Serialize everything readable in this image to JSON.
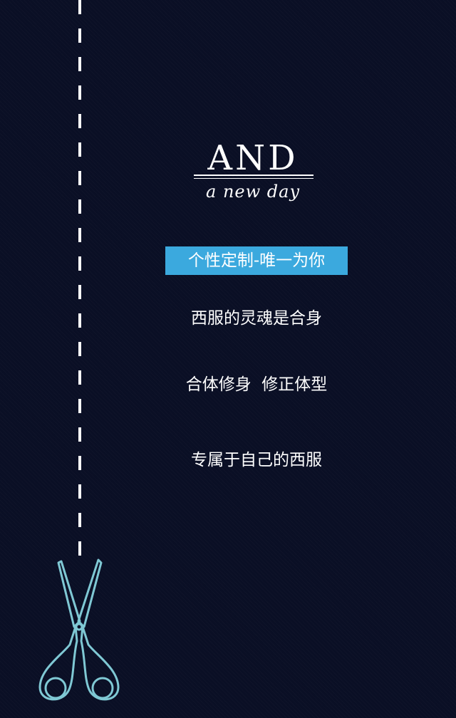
{
  "brand": {
    "title": "AND",
    "tagline": "a new day"
  },
  "badge": {
    "text": "个性定制-唯一为你"
  },
  "lines": [
    "西服的灵魂是合身",
    "合体修身  修正体型",
    "专属于自己的西服"
  ],
  "colors": {
    "background": "#0a0f25",
    "accent": "#3ba9de",
    "scissors": "#7fc8d4",
    "text": "#ffffff"
  },
  "icons": {
    "scissors": "scissors-icon",
    "cut_line": "dashed-cut-line"
  }
}
